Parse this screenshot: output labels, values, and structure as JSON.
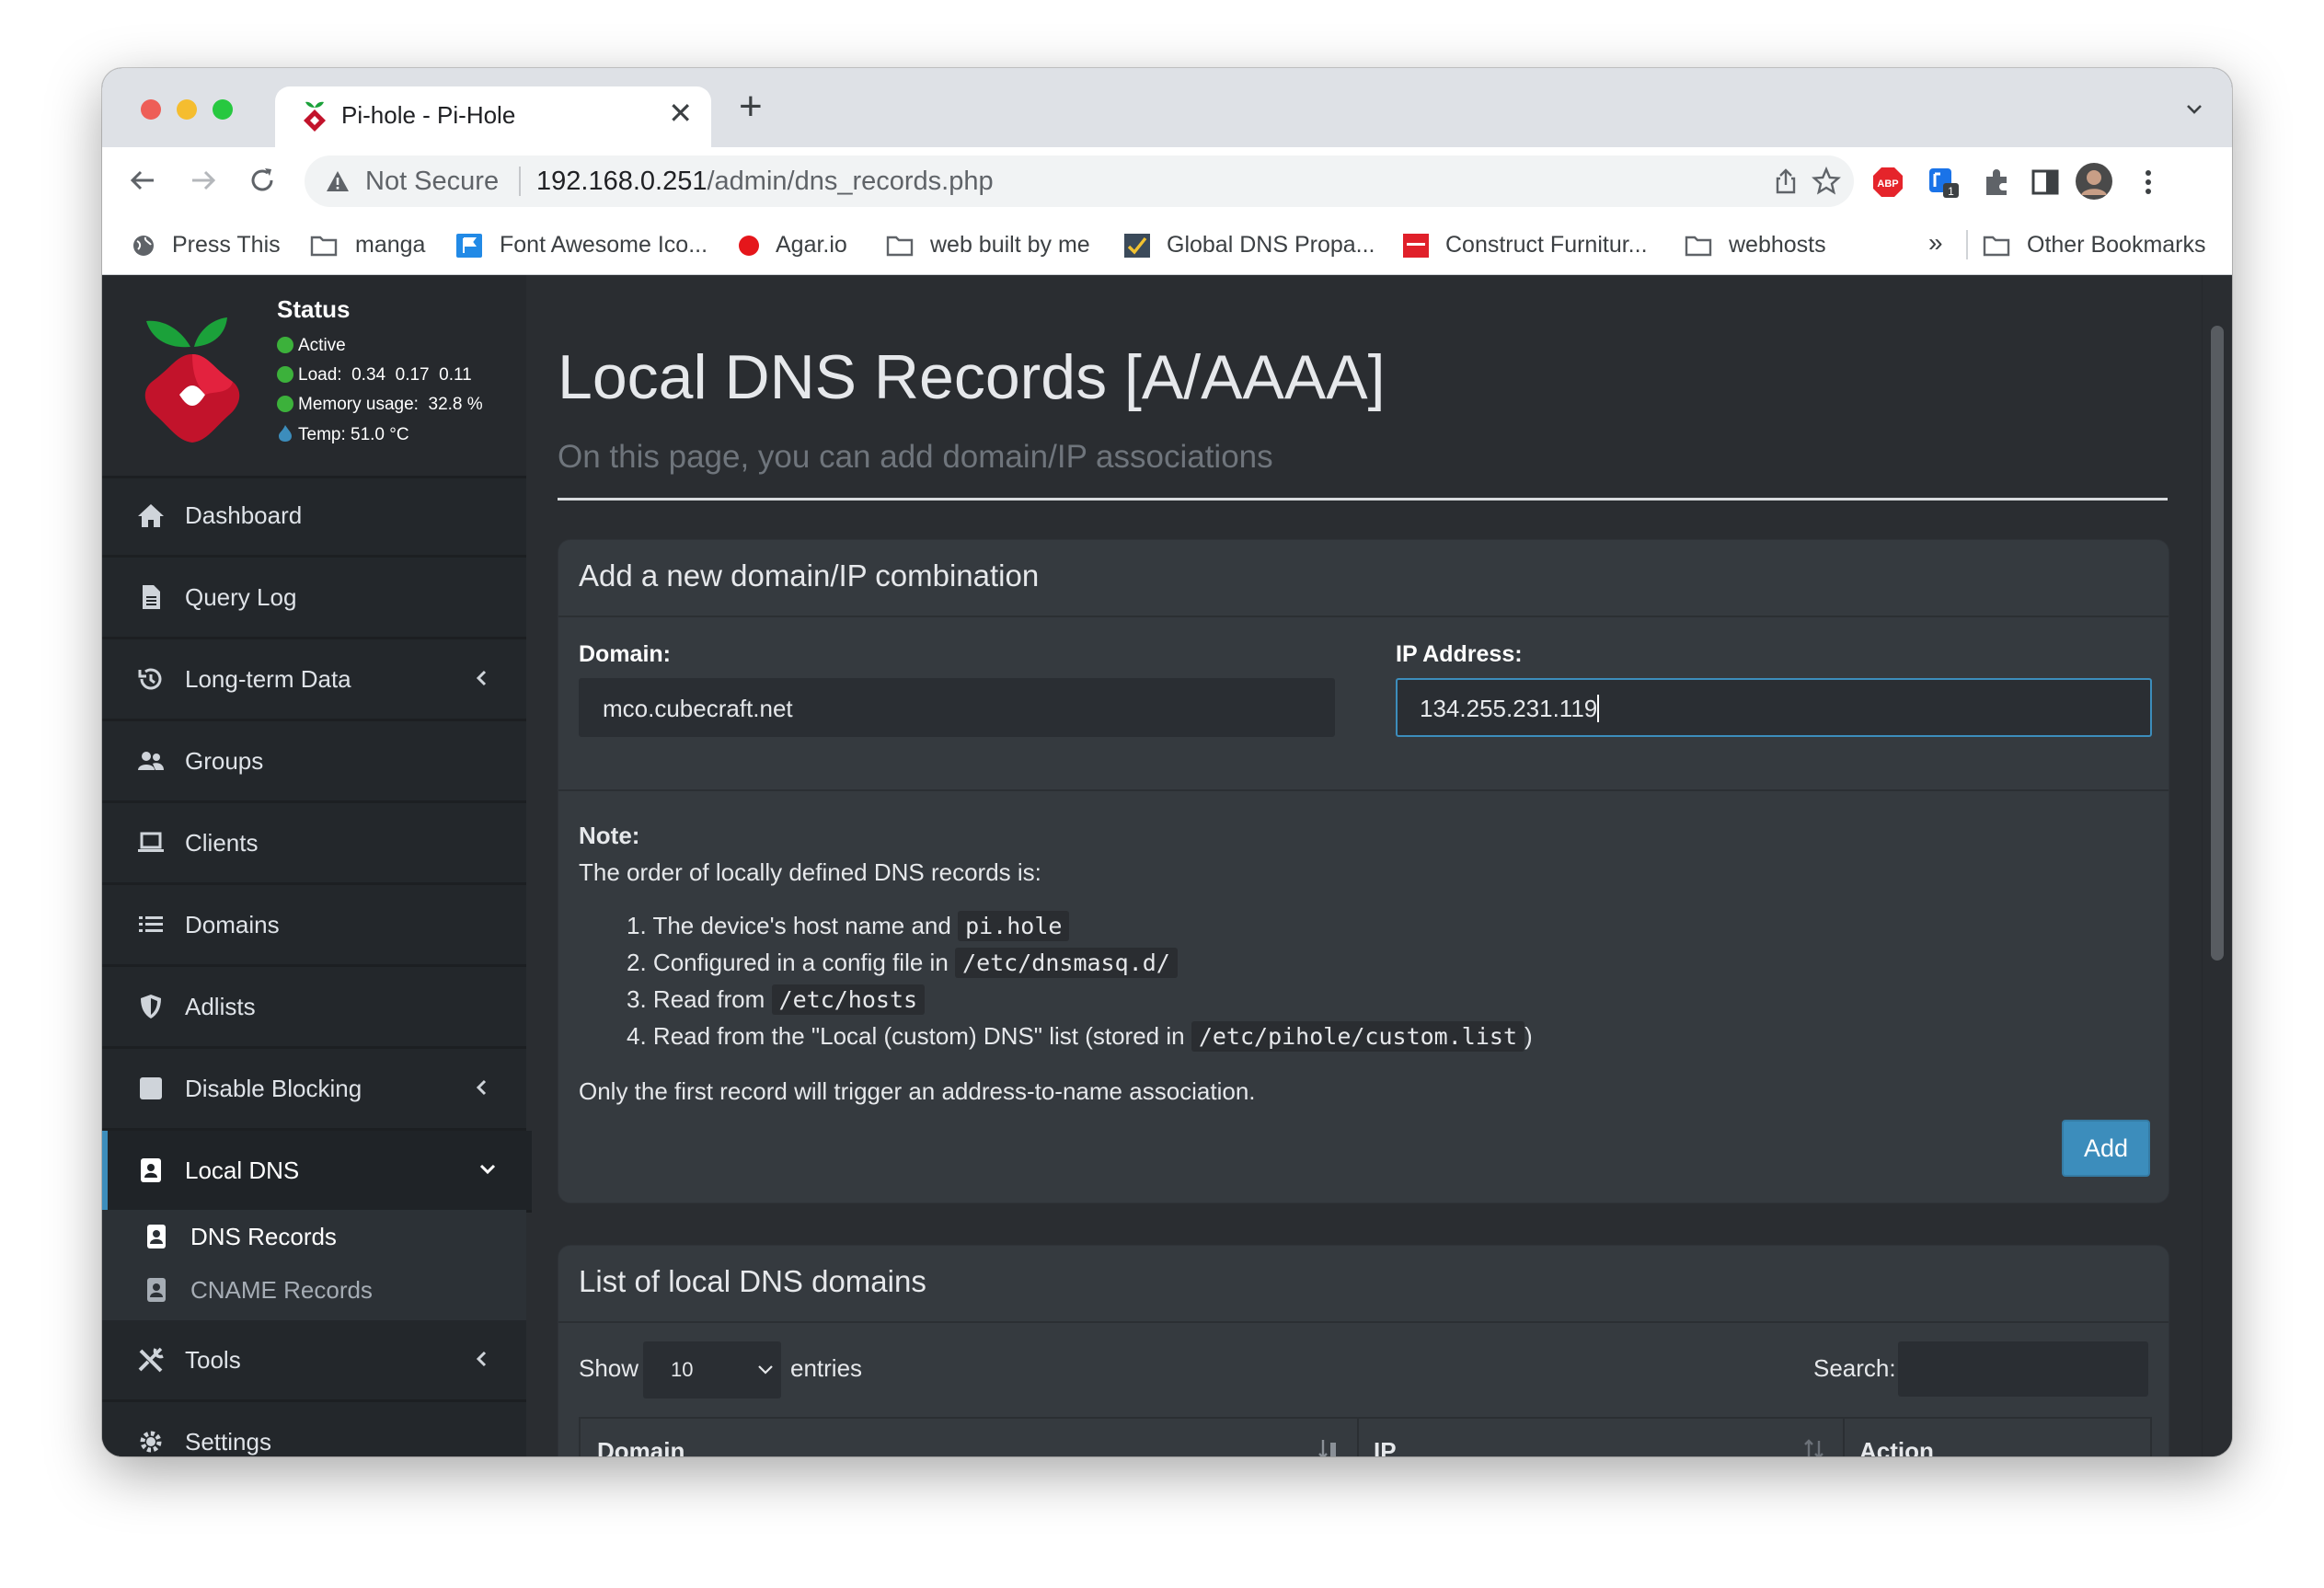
{
  "browser": {
    "tab_title": "Pi-hole - Pi-Hole",
    "close_glyph": "✕",
    "new_tab_glyph": "+",
    "not_secure": "Not Secure",
    "url_host": "192.168.0.251",
    "url_path": "/admin/dns_records.php",
    "extension_badge": "1",
    "abp_label": "ABP",
    "bookmarks": [
      {
        "label": "Press This",
        "icon": "globe-icon"
      },
      {
        "label": "manga",
        "icon": "folder-icon"
      },
      {
        "label": "Font Awesome Ico...",
        "icon": "flag-icon"
      },
      {
        "label": "Agar.io",
        "icon": "circle-icon"
      },
      {
        "label": "web built by me",
        "icon": "folder-icon"
      },
      {
        "label": "Global DNS Propa...",
        "icon": "check-icon"
      },
      {
        "label": "Construct Furnitur...",
        "icon": "image-icon"
      },
      {
        "label": "webhosts",
        "icon": "folder-icon"
      }
    ],
    "bookmarks_overflow": "»",
    "other_bookmarks": "Other Bookmarks"
  },
  "status": {
    "title": "Status",
    "active": "Active",
    "load": "Load:  0.34  0.17  0.11",
    "memory": "Memory usage:  32.8 %",
    "temp": "Temp: 51.0 °C"
  },
  "sidebar": {
    "items": [
      {
        "label": "Dashboard",
        "icon": "home-icon"
      },
      {
        "label": "Query Log",
        "icon": "file-icon"
      },
      {
        "label": "Long-term Data",
        "icon": "history-icon"
      },
      {
        "label": "Groups",
        "icon": "users-icon"
      },
      {
        "label": "Clients",
        "icon": "laptop-icon"
      },
      {
        "label": "Domains",
        "icon": "list-icon"
      },
      {
        "label": "Adlists",
        "icon": "shield-icon"
      },
      {
        "label": "Disable Blocking",
        "icon": "stop-icon"
      },
      {
        "label": "Local DNS",
        "icon": "address-book-icon"
      },
      {
        "label": "Tools",
        "icon": "tools-icon"
      },
      {
        "label": "Settings",
        "icon": "gear-icon"
      }
    ],
    "sub_items": [
      {
        "label": "DNS Records"
      },
      {
        "label": "CNAME Records"
      }
    ]
  },
  "main": {
    "title": "Local DNS Records [A/AAAA]",
    "subtitle": "On this page, you can add domain/IP associations",
    "add_box": {
      "title": "Add a new domain/IP combination",
      "domain_label": "Domain:",
      "domain_value": "mco.cubecraft.net",
      "ip_label": "IP Address:",
      "ip_value": "134.255.231.119",
      "note_title": "Note:",
      "note_intro": "The order of locally defined DNS records is:",
      "list": [
        {
          "num": "1.",
          "text": "The device's host name and",
          "code": "pi.hole",
          "after": ""
        },
        {
          "num": "2.",
          "text": "Configured in a config file in",
          "code": "/etc/dnsmasq.d/",
          "after": ""
        },
        {
          "num": "3.",
          "text": "Read from",
          "code": "/etc/hosts",
          "after": ""
        },
        {
          "num": "4.",
          "text": "Read from the \"Local (custom) DNS\" list (stored in",
          "code": "/etc/pihole/custom.list",
          "after": ")"
        }
      ],
      "note_footer": "Only the first record will trigger an address-to-name association.",
      "add_button": "Add"
    },
    "list_box": {
      "title": "List of local DNS domains",
      "show": "Show",
      "entries_value": "10",
      "entries": "entries",
      "search": "Search:",
      "columns": [
        "Domain",
        "IP",
        "Action"
      ]
    }
  },
  "colors": {
    "accent": "#3c8dbc",
    "status_green": "#3cb13b",
    "sidebar_bg": "#23272b",
    "content_bg": "#2a2d31"
  }
}
